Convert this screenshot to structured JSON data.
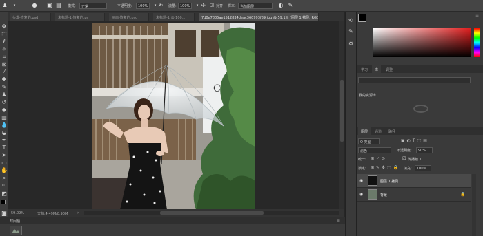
{
  "options_bar": {
    "mode_label": "模式:",
    "mode_value": "正常",
    "opacity_label": "不透明度:",
    "opacity_value": "100%",
    "flow_label": "流量:",
    "flow_value": "100%",
    "align_label": "对齐",
    "sample_label": "样本:",
    "sample_value": "当前图层"
  },
  "tabs": [
    {
      "label": "头发-恢复的.psd"
    },
    {
      "label": "未标题-1-恢复的.ps"
    },
    {
      "label": "画面-恢复的.psd"
    },
    {
      "label": "未标题-1 @ 100..."
    },
    {
      "label": "7d0e7805ae1512834deac360993f89.jpg @ 59.1% (图层 1 拷贝, RGB/8#) *"
    }
  ],
  "status": {
    "zoom": "59.09%",
    "doc": "文档:4.49M/8.90M"
  },
  "timeline": {
    "title": "时间轴"
  },
  "color_panel": {
    "fg_color": "#000000",
    "bg_color": "#1a2fe0"
  },
  "library_panel": {
    "tabs": [
      "学习",
      "库",
      "调整"
    ],
    "dropdown": "我的资源库"
  },
  "layers_panel": {
    "tabs": [
      "图层",
      "通道",
      "路径"
    ],
    "filter_label": "Q 类型",
    "blend_mode": "滤色",
    "opacity_label": "不透明度:",
    "opacity_value": "90%",
    "unify_label": "统一:",
    "propagate_label": "传播帧 1",
    "lock_label": "锁定:",
    "fill_label": "填充:",
    "fill_value": "100%",
    "layers": [
      {
        "name": "图层 1 拷贝",
        "selected": true
      },
      {
        "name": "背景",
        "selected": false
      }
    ]
  }
}
